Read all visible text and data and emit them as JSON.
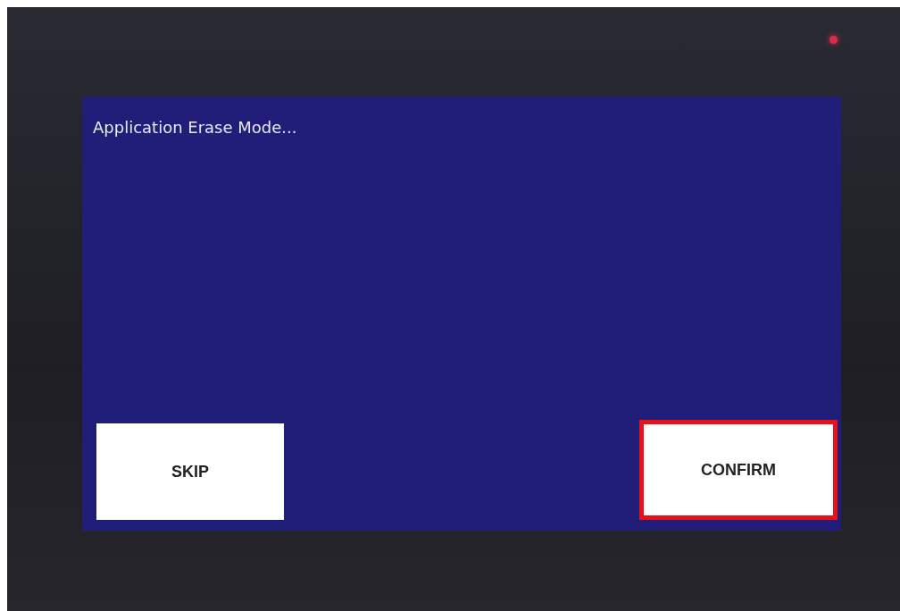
{
  "device": {
    "led_on": true
  },
  "screen": {
    "message": "Application Erase Mode..."
  },
  "buttons": [
    {
      "label": "SKIP",
      "highlighted": false
    },
    {
      "label": "CONFIRM",
      "highlighted": true
    }
  ]
}
